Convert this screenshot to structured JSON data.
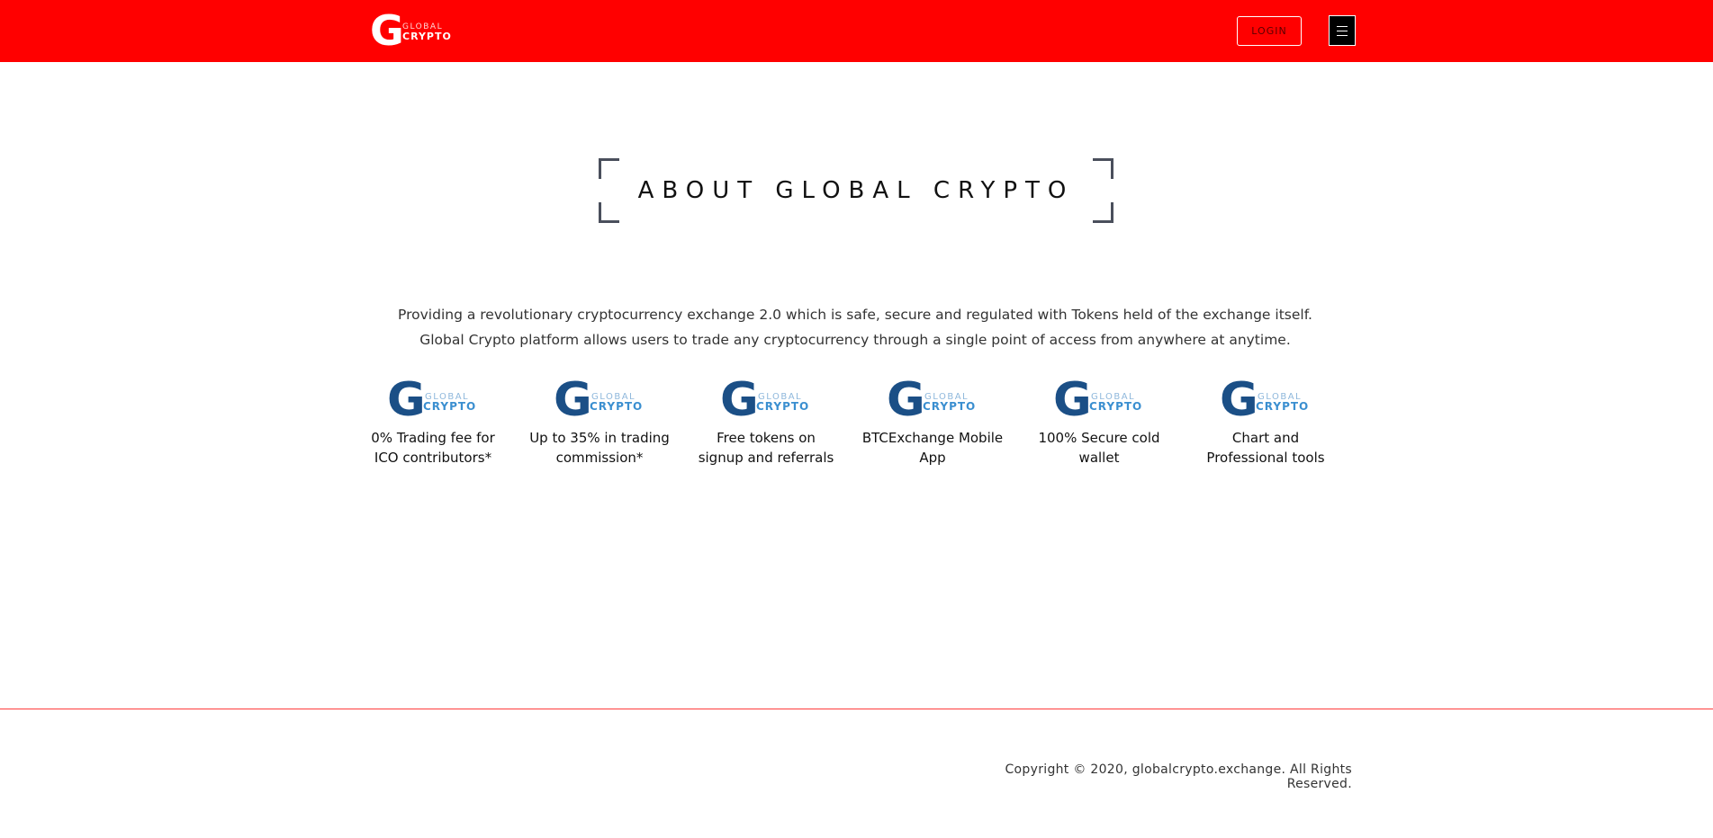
{
  "header": {
    "logo": {
      "word_top": "GLOBAL",
      "word_bottom": "CRYPTO",
      "letter": "G"
    },
    "login_label": "LOGIN",
    "menu_icon": "hamburger-icon"
  },
  "about": {
    "title": "ABOUT GLOBAL CRYPTO",
    "paragraph_line1": "Providing a revolutionary cryptocurrency exchange 2.0 which is safe, secure and regulated with Tokens held of the exchange itself.",
    "paragraph_line2": "Global Crypto platform allows users to trade any cryptocurrency through a single point of access from anywhere at anytime."
  },
  "features": [
    {
      "line1": "0% Trading fee for",
      "line2": "ICO contributors*"
    },
    {
      "line1": "Up to 35% in trading",
      "line2": "commission*"
    },
    {
      "line1": "Free tokens on",
      "line2": "signup and referrals"
    },
    {
      "line1": "BTCExchange Mobile",
      "line2": "App"
    },
    {
      "line1": "100% Secure cold",
      "line2": "wallet"
    },
    {
      "line1": "Chart and",
      "line2": "Professional tools"
    }
  ],
  "footer": {
    "copyright": "Copyright © 2020, globalcrypto.exchange. All Rights Reserved."
  },
  "colors": {
    "header_bg": "#ff0000",
    "logo_blue_dark": "#1b4f86",
    "logo_blue_light": "#3b8fd0",
    "footer_line": "#ff3b3b"
  }
}
